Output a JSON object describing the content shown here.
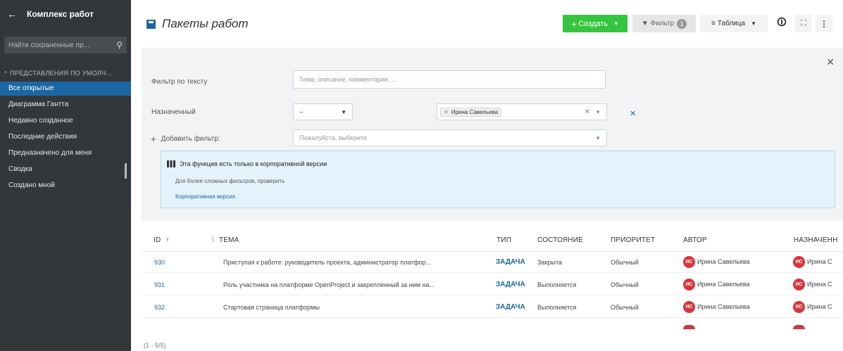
{
  "sidebar": {
    "title": "Комплекс работ",
    "search_placeholder": "Найти сохраненные пр...",
    "section_title": "ПРЕДСТАВЛЕНИЯ ПО УМОЛЧ...",
    "items": [
      {
        "label": "Все открытые",
        "active": true
      },
      {
        "label": "Диаграмма Гантта"
      },
      {
        "label": "Недавно созданное"
      },
      {
        "label": "Последние действия"
      },
      {
        "label": "Предназначено для меня"
      },
      {
        "label": "Сводка"
      },
      {
        "label": "Создано мной"
      }
    ]
  },
  "header": {
    "title": "Пакеты работ",
    "create_label": "Создать",
    "filter_label": "Фильтр",
    "filter_count": "1",
    "view_label": "Таблица"
  },
  "filters": {
    "text_label": "Фильтр по тексту",
    "text_placeholder": "Тема, описание, комментарии, ...",
    "assignee_label": "Назначенный",
    "assignee_operator": "–",
    "assignee_value": "Ирина Савельева",
    "add_label": "Добавить фильтр:",
    "add_placeholder": "Пожалуйста, выберите"
  },
  "enterprise": {
    "title": "Эта функция есть только в корпоративной версии",
    "line": "Для более сложных фильтров, проверить",
    "link": "Корпоративная версия."
  },
  "table": {
    "headers": {
      "id": "ID",
      "sort": "↑",
      "subject": "ТЕМА",
      "type": "ТИП",
      "status": "СОСТОЯНИЕ",
      "priority": "ПРИОРИТЕТ",
      "author": "АВТОР",
      "assignee": "НАЗНАЧЕНН"
    },
    "rows": [
      {
        "id": "930",
        "subject": "Приступая к работе: руководитель проекта, администратор платфор...",
        "type": "ЗАДАЧА",
        "status": "Закрыта",
        "priority": "Обычный",
        "author": "Ирина Савельева",
        "assignee": "Ирина С",
        "initials": "ИС"
      },
      {
        "id": "931",
        "subject": "Роль участника на платформе OpenProject и закрепленный за ним на...",
        "type": "ЗАДАЧА",
        "status": "Выполняется",
        "priority": "Обычный",
        "author": "Ирина Савельева",
        "assignee": "Ирина С",
        "initials": "ИС"
      },
      {
        "id": "932",
        "subject": "Стартовая страница платформы",
        "type": "ЗАДАЧА",
        "status": "Выполняется",
        "priority": "Обычный",
        "author": "Ирина Савельева",
        "assignee": "Ирина С",
        "initials": "ИС"
      }
    ],
    "pagination": "(1 - 5/5)"
  },
  "colors": {
    "sidebar_bg": "#333739",
    "active_item": "#1a67a3",
    "create_button": "#35c53f",
    "link": "#1a67a3",
    "avatar": "#d9353b"
  }
}
